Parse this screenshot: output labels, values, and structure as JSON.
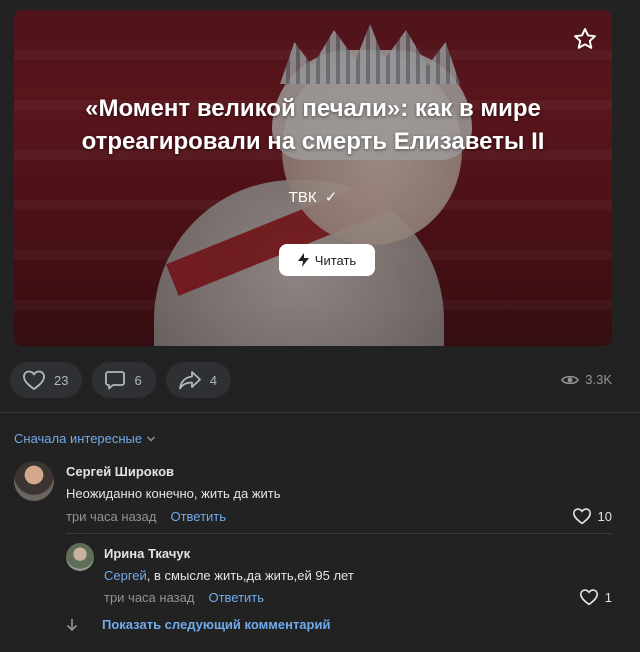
{
  "article": {
    "title": "«Момент великой печали»: как в мире отреагировали на смерть Елизаветы II",
    "source": "ТВК",
    "read_label": "Читать"
  },
  "actions": {
    "likes": "23",
    "comments": "6",
    "shares": "4",
    "views": "3.3K"
  },
  "comments_section": {
    "sort_label": "Сначала интересные",
    "comments": [
      {
        "author": "Сергей Широков",
        "text": "Неожиданно конечно, жить да жить",
        "time": "три часа назад",
        "reply_label": "Ответить",
        "likes": "10"
      }
    ],
    "replies": [
      {
        "author": "Ирина Ткачук",
        "mention": "Сергей",
        "text": ", в смысле жить,да жить,ей 95 лет",
        "time": "три часа назад",
        "reply_label": "Ответить",
        "likes": "1"
      }
    ],
    "show_next_label": "Показать следующий комментарий"
  },
  "colors": {
    "background": "#222222",
    "accent": "#71aaeb",
    "pill": "#2f3033"
  }
}
